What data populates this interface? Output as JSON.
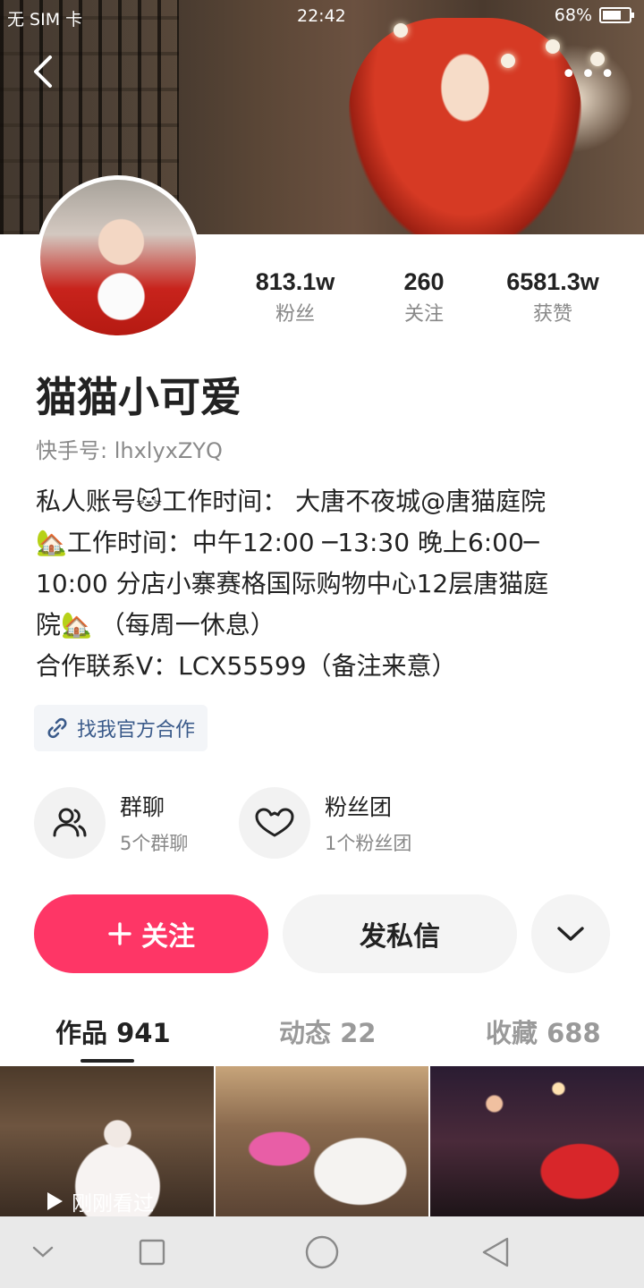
{
  "status_bar": {
    "carrier": "无 SIM 卡",
    "time": "22:42",
    "battery": "68%"
  },
  "header": {
    "back_icon": "back-arrow-icon",
    "more_icon": "more-dots-icon"
  },
  "profile": {
    "name": "猫猫小可爱",
    "kuaishou_id": "快手号: lhxlyxZYQ",
    "bio_lines": [
      "私人账号🐱工作时间： 大唐不夜城@唐猫庭院",
      "🏡工作时间：中午12:00 ─13:30 晚上6:00─",
      "10:00 分店小寨赛格国际购物中心12层唐猫庭",
      "院🏡 （每周一休息）",
      "合作联系V：LCX55599（备注来意）"
    ],
    "official_link": "找我官方合作"
  },
  "stats": [
    {
      "value": "813.1w",
      "label": "粉丝"
    },
    {
      "value": "260",
      "label": "关注"
    },
    {
      "value": "6581.3w",
      "label": "获赞"
    }
  ],
  "groups": [
    {
      "title": "群聊",
      "subtitle": "5个群聊",
      "icon": "group-chat-icon"
    },
    {
      "title": "粉丝团",
      "subtitle": "1个粉丝团",
      "icon": "heart-icon"
    }
  ],
  "actions": {
    "follow": "关注",
    "message": "发私信"
  },
  "tabs": [
    {
      "label": "作品 941",
      "active": true
    },
    {
      "label": "动态 22",
      "active": false
    },
    {
      "label": "收藏 688",
      "active": false
    }
  ],
  "thumbnails": {
    "watched_label": "刚刚看过"
  },
  "colors": {
    "accent": "#fe3666",
    "link": "#3a5a8a"
  }
}
